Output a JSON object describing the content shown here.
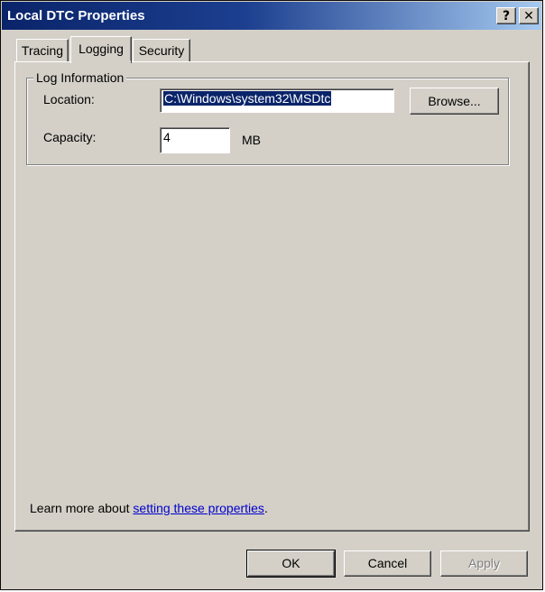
{
  "window": {
    "title": "Local DTC Properties",
    "help_glyph": "?",
    "close_glyph": "✕"
  },
  "tabs": [
    {
      "label": "Tracing"
    },
    {
      "label": "Logging",
      "active": true
    },
    {
      "label": "Security"
    }
  ],
  "log_info": {
    "group_label": "Log Information",
    "location_label": "Location:",
    "location_value": "C:\\Windows\\system32\\MSDtc",
    "browse_label": "Browse...",
    "capacity_label": "Capacity:",
    "capacity_value": "4",
    "capacity_unit": "MB"
  },
  "learn_more": {
    "prefix": "Learn more about ",
    "link": "setting these properties",
    "suffix": "."
  },
  "buttons": {
    "ok": "OK",
    "cancel": "Cancel",
    "apply": "Apply"
  },
  "colors": {
    "title_start": "#0a246a",
    "title_end": "#a6caf0",
    "face": "#d4d0c8",
    "link": "#0000cc"
  }
}
